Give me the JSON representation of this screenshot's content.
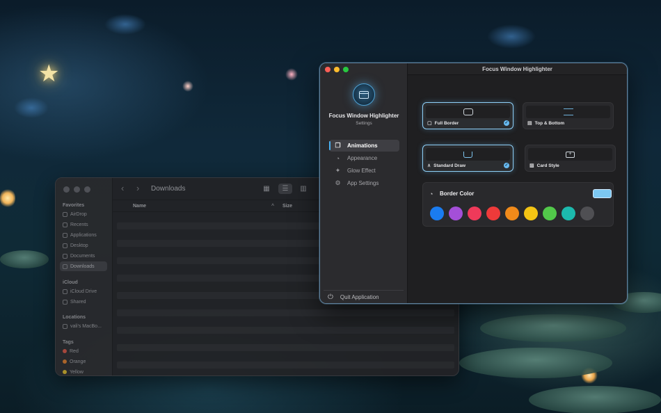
{
  "finder": {
    "title": "Downloads",
    "columns": {
      "name": "Name",
      "size": "Size"
    },
    "sidebar": {
      "favorites_label": "Favorites",
      "favorites": [
        "AirDrop",
        "Recents",
        "Applications",
        "Desktop",
        "Documents",
        "Downloads"
      ],
      "icloud_label": "iCloud",
      "icloud": [
        "iCloud Drive",
        "Shared"
      ],
      "locations_label": "Locations",
      "locations": [
        "vali's MacBo..."
      ],
      "tags_label": "Tags",
      "tags": [
        {
          "label": "Red",
          "color": "#b24a3e"
        },
        {
          "label": "Orange",
          "color": "#b86a2a"
        },
        {
          "label": "Yellow",
          "color": "#b79a2a"
        }
      ]
    }
  },
  "app": {
    "window_title": "Focus Window Highlighter",
    "name": "Focus Window Highlighter",
    "subtitle": "Settings",
    "nav": [
      {
        "label": "Animations",
        "icon": "copy-icon",
        "active": true
      },
      {
        "label": "Appearance",
        "icon": "palette-icon",
        "active": false
      },
      {
        "label": "Glow Effect",
        "icon": "sparkle-icon",
        "active": false
      },
      {
        "label": "App Settings",
        "icon": "gear-icon",
        "active": false
      }
    ],
    "quit_label": "Quit Application",
    "border_styles": [
      {
        "label": "Full Border",
        "selected": true
      },
      {
        "label": "Top & Bottom",
        "selected": false
      }
    ],
    "animation_styles": [
      {
        "label": "Standard Draw",
        "selected": true
      },
      {
        "label": "Card Style",
        "selected": false
      }
    ],
    "border_color": {
      "title": "Border Color",
      "current": "#7cc8f2",
      "swatches": [
        "#1a7cf0",
        "#a44fd8",
        "#ef3a5a",
        "#ee3a3a",
        "#f08a1a",
        "#f3c414",
        "#52c84a",
        "#1cb9ad",
        "#4f4f53"
      ]
    }
  }
}
